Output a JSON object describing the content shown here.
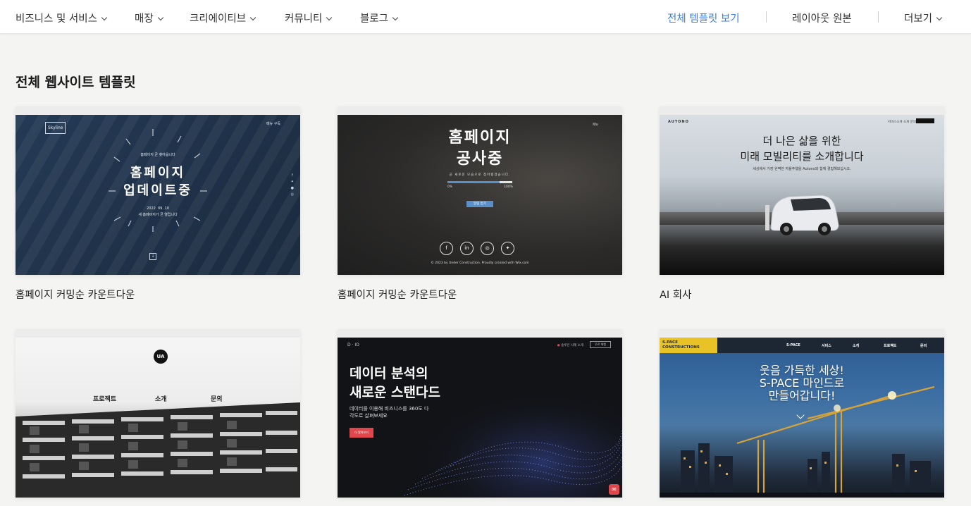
{
  "nav": {
    "items": [
      {
        "label": "비즈니스 및 서비스"
      },
      {
        "label": "매장"
      },
      {
        "label": "크리에이티브"
      },
      {
        "label": "커뮤니티"
      },
      {
        "label": "블로그"
      }
    ],
    "view_all": "전체 템플릿 보기",
    "layout_original": "레이아웃 원본",
    "more": "더보기",
    "accent_color": "#3b7de0"
  },
  "section_title": "전체 웹사이트 템플릿",
  "cards": [
    {
      "title": "홈페이지 커밍순 카운트다운",
      "preview": {
        "logo": "Skyline",
        "menu": "메뉴   구독",
        "kicker": "홈페이지 곧 찾아옵니다",
        "headline_1": "홈페이지",
        "headline_2": "업데이트중",
        "date": "2022. 09. 10",
        "note": "새 홈페이지가 곧 열립니다"
      }
    },
    {
      "title": "홈페이지 커밍순 카운트다운",
      "preview": {
        "menu": "메뉴",
        "headline_1": "홈페이지",
        "headline_2": "공사중",
        "sub": "곧 새로운 모습으로 찾아뵙겠습니다.",
        "progress": 0.8,
        "progress_start": "0%",
        "progress_end": "100%",
        "button": "알림 받기",
        "footer": "© 2023 by Under Construction. Proudly created with Wix.com"
      }
    },
    {
      "title": "AI 회사",
      "preview": {
        "brand": "AUTONO",
        "menu": "서비스소개   소개   문의",
        "headline_1": "더 나은 삶을 위한",
        "headline_2": "미래 모빌리티를 소개합니다",
        "sub": "세상에서 가장 완벽한 자율주행을 Autono와 함께 경험해보십시오."
      }
    },
    {
      "title": "",
      "preview": {
        "badge": "UA",
        "menu": [
          "프로젝트",
          "소개",
          "문의"
        ]
      }
    },
    {
      "title": "",
      "preview": {
        "brand": "D · IO",
        "menu": "솔루션   사례   소개",
        "button": "무료 체험",
        "headline_1": "데이터 분석의",
        "headline_2": "새로운 스탠다드",
        "sub_1": "데이터를 이용해 비즈니스를 360도 다",
        "sub_2": "각도로 살펴보세요",
        "cta": "더 알아보기",
        "accent_color": "#e0474c"
      }
    },
    {
      "title": "",
      "preview": {
        "logo_1": "S-PACE",
        "logo_2": "CONSTRUCTIONS",
        "menu": [
          "S-PACE",
          "서비스",
          "소개",
          "프로젝트",
          "문의"
        ],
        "headline_1": "웃음 가득한 세상!",
        "headline_2": "S-PACE 마인드로",
        "headline_3": "만들어갑니다!",
        "accent_color": "#e9c326"
      }
    }
  ]
}
